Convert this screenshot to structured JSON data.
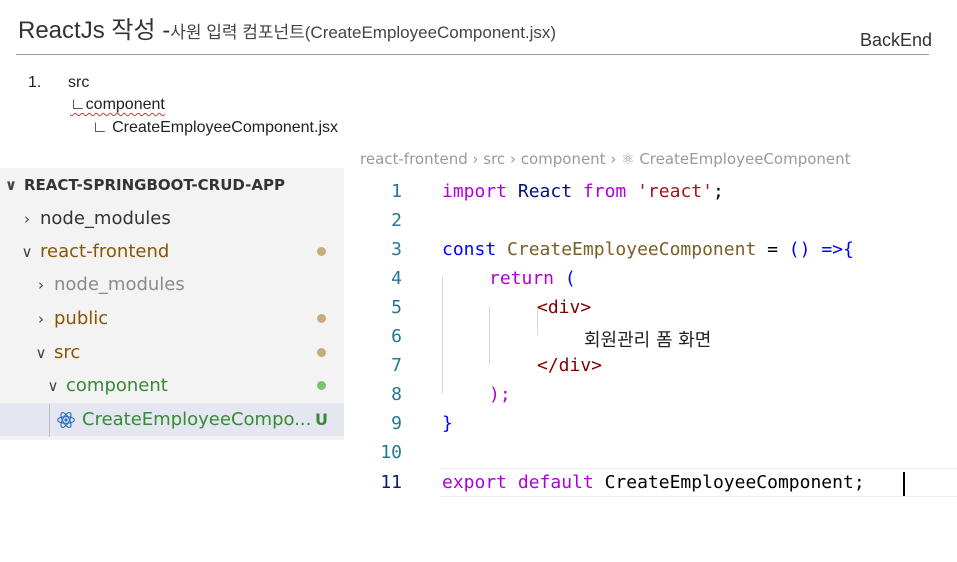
{
  "slide": {
    "title_main": "ReactJs 작성 -",
    "title_sub": "사원 입력 컴포넌트(CreateEmployeeComponent.jsx)",
    "backend_label": "BackEnd"
  },
  "outline": {
    "number": "1.",
    "src": "src",
    "component": "∟component",
    "file": "∟ CreateEmployeeComponent.jsx"
  },
  "explorer": {
    "root_label": "REACT-SPRINGBOOT-CRUD-APP",
    "items": [
      {
        "label": "node_modules"
      },
      {
        "label": "react-frontend"
      },
      {
        "label": "node_modules"
      },
      {
        "label": "public"
      },
      {
        "label": "src"
      },
      {
        "label": "component"
      },
      {
        "label": "CreateEmployeeCompo...",
        "badge": "U"
      }
    ],
    "colors": {
      "panel_bg": "#f3f3f3",
      "selected_bg": "#e4e6f1",
      "modified": "#895503",
      "untracked": "#388a34",
      "react_icon": "#2b6cc4"
    }
  },
  "editor": {
    "breadcrumb": "react-frontend › src › component › ⚛ CreateEmployeeComponent",
    "lines": [
      {
        "n": "1",
        "t": [
          "import",
          " React ",
          "from",
          " ",
          "'react'",
          ";"
        ]
      },
      {
        "n": "2",
        "t": []
      },
      {
        "n": "3",
        "t": [
          "const",
          " ",
          "CreateEmployeeComponent",
          " = ",
          "()",
          " ",
          "=>",
          "{"
        ]
      },
      {
        "n": "4",
        "t": [
          "return",
          " ("
        ]
      },
      {
        "n": "5",
        "t": [
          "<div>"
        ]
      },
      {
        "n": "6",
        "t": [
          "회원관리 폼 화면"
        ]
      },
      {
        "n": "7",
        "t": [
          "</div>"
        ]
      },
      {
        "n": "8",
        "t": [
          ");"
        ]
      },
      {
        "n": "9",
        "t": [
          "}"
        ]
      },
      {
        "n": "10",
        "t": []
      },
      {
        "n": "11",
        "t": [
          "export",
          " ",
          "default",
          " CreateEmployeeComponent;"
        ]
      }
    ],
    "colors": {
      "keyword_control": "#af00db",
      "keyword_storage": "#0000ff",
      "string": "#a31515",
      "function_name": "#795e26",
      "tag": "#800000",
      "line_number": "#237893"
    }
  }
}
